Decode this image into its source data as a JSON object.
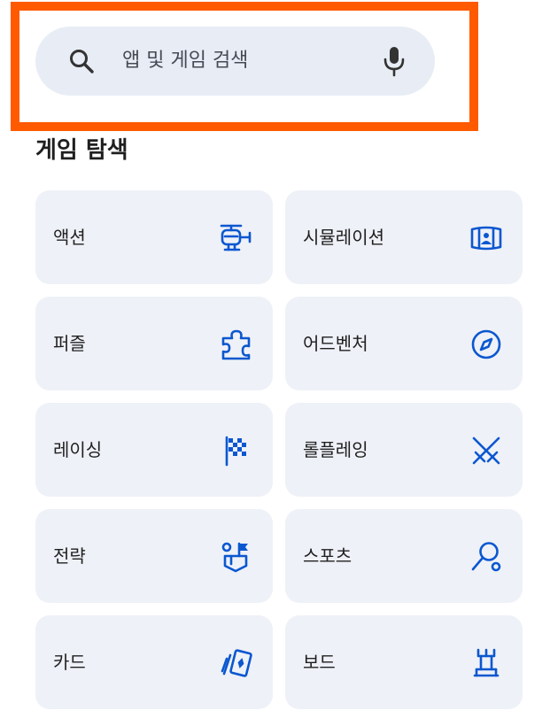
{
  "search": {
    "placeholder": "앱 및 게임 검색",
    "left_icon": "search-icon",
    "right_icon": "mic-icon"
  },
  "section": {
    "title": "게임 탐색"
  },
  "categories": [
    {
      "label": "액션",
      "icon": "helicopter-icon"
    },
    {
      "label": "시뮬레이션",
      "icon": "simulator-icon"
    },
    {
      "label": "퍼즐",
      "icon": "puzzle-icon"
    },
    {
      "label": "어드벤처",
      "icon": "compass-icon"
    },
    {
      "label": "레이싱",
      "icon": "checkered-flag-icon"
    },
    {
      "label": "롤플레잉",
      "icon": "crossed-swords-icon"
    },
    {
      "label": "전략",
      "icon": "strategy-icon"
    },
    {
      "label": "스포츠",
      "icon": "racket-icon"
    },
    {
      "label": "카드",
      "icon": "cards-icon"
    },
    {
      "label": "보드",
      "icon": "chess-piece-icon"
    }
  ],
  "colors": {
    "highlight_border": "#ff5a00",
    "search_background": "#e8edf5",
    "tile_background": "#eef1f7",
    "icon_accent": "#0b57d0"
  }
}
